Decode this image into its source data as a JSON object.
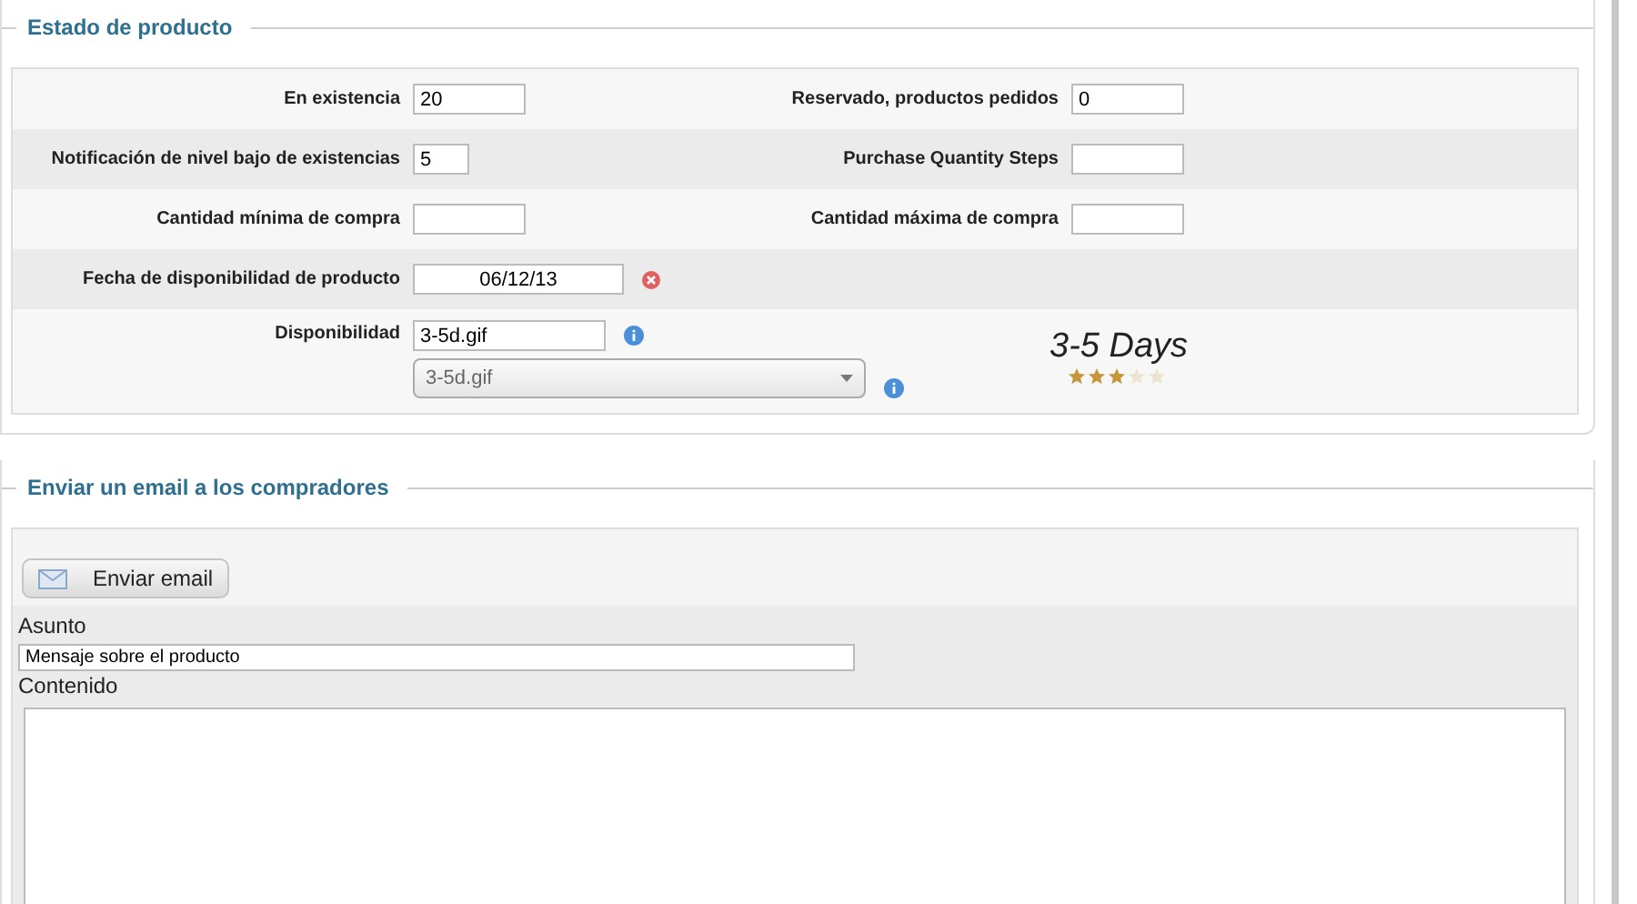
{
  "status": {
    "legend": "Estado de producto",
    "rows": [
      {
        "left": {
          "label": "En existencia",
          "value": "20",
          "kind": "medium"
        },
        "right": {
          "label": "Reservado, productos pedidos",
          "value": "0",
          "kind": "medium"
        }
      },
      {
        "left": {
          "label": "Notificación de nivel bajo de existencias",
          "value": "5",
          "kind": "short"
        },
        "right": {
          "label": "Purchase Quantity Steps",
          "kind": "medium"
        }
      },
      {
        "left": {
          "label": "Cantidad mínima de compra",
          "kind": "medium"
        },
        "right": {
          "label": "Cantidad máxima de compra",
          "kind": "medium"
        }
      },
      {
        "left": {
          "label": "Fecha de disponibilidad de producto",
          "value": "06/12/13",
          "kind": "date"
        }
      }
    ],
    "availability": {
      "label": "Disponibilidad",
      "value": "3-5d.gif",
      "select": "3-5d.gif",
      "preview": "3-5 Days",
      "stars": 3
    }
  },
  "email": {
    "legend": "Enviar un email a los compradores",
    "button": "Enviar email",
    "subject_label": "Asunto",
    "subject": "Mensaje sobre el producto",
    "content_label": "Contenido"
  }
}
